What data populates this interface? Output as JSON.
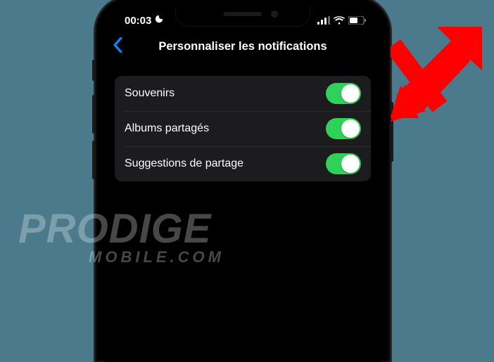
{
  "status": {
    "time": "00:03",
    "dnd": true,
    "signal_bars": 4,
    "wifi": true,
    "battery_pct": 55
  },
  "nav": {
    "title": "Personnaliser les notifications"
  },
  "settings": [
    {
      "label": "Souvenirs",
      "value": true
    },
    {
      "label": "Albums partagés",
      "value": true
    },
    {
      "label": "Suggestions de partage",
      "value": true
    }
  ],
  "watermark": {
    "line1": "PRODIGE",
    "line2": "MOBILE.COM"
  },
  "colors": {
    "background": "#4a7a8c",
    "toggle_on": "#30d158",
    "accent_blue": "#0a84ff",
    "arrow": "#ff0000"
  }
}
